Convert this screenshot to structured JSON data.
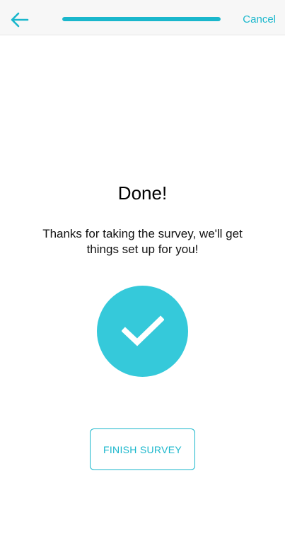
{
  "header": {
    "back_icon": "arrow-left-icon",
    "cancel_label": "Cancel",
    "progress": 1.0
  },
  "content": {
    "title": "Done!",
    "message": "Thanks for taking the survey, we'll get things set up for you!",
    "status_icon": "checkmark-icon",
    "finish_label": "FINISH SURVEY"
  },
  "colors": {
    "accent": "#1ab7cc",
    "check_circle": "#35c9da",
    "header_bg": "#f7f7f7"
  }
}
